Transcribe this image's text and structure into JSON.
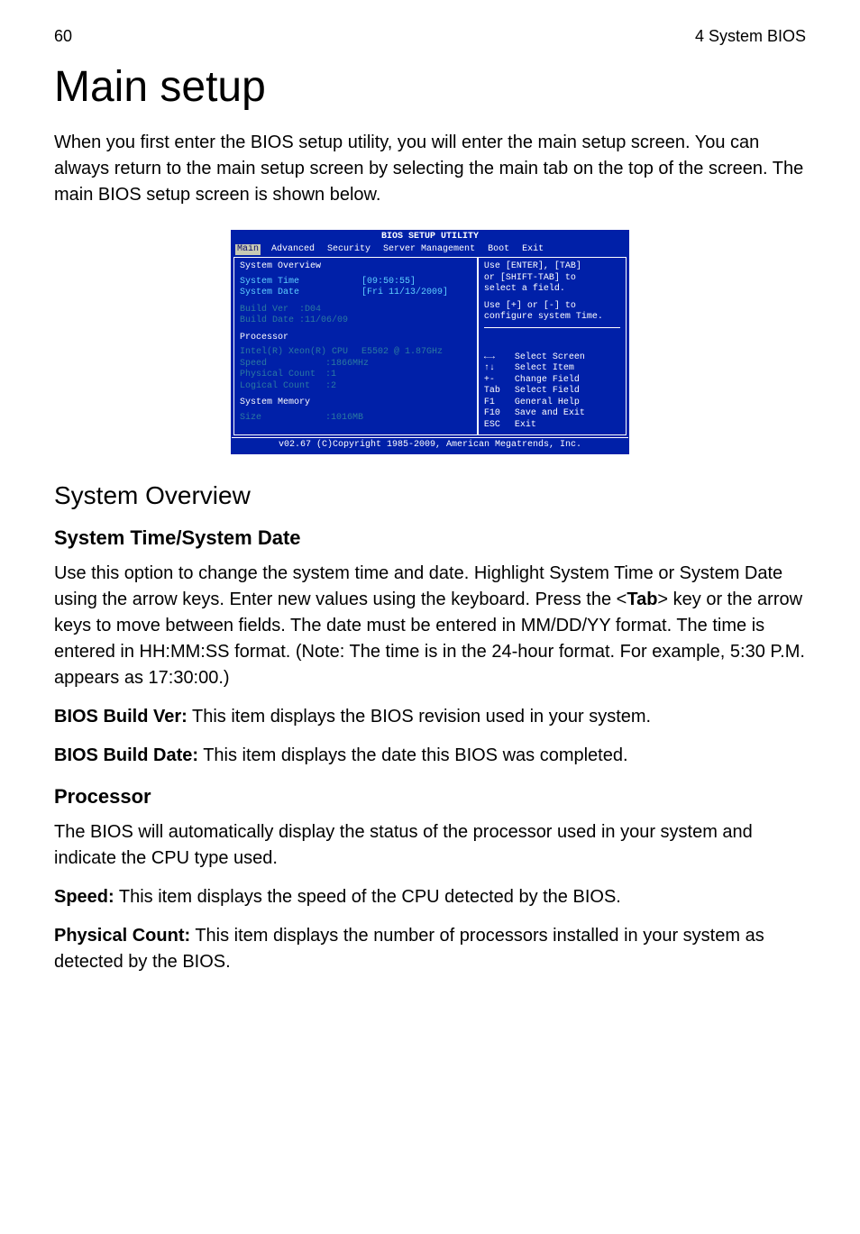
{
  "header": {
    "page_number": "60",
    "chapter": "4 System BIOS"
  },
  "title": "Main setup",
  "intro": "When you first enter the BIOS setup utility, you will enter the main setup screen. You can always return to the main setup screen by selecting the main tab on the top of the screen. The main BIOS setup screen is shown below.",
  "bios": {
    "title": "BIOS SETUP UTILITY",
    "tabs": [
      "Main",
      "Advanced",
      "Security",
      "Server Management",
      "Boot",
      "Exit"
    ],
    "active_tab": "Main",
    "left": {
      "overview_heading": "System Overview",
      "system_time_label": "System Time",
      "system_time_value": "[09:50:55]",
      "system_date_label": "System Date",
      "system_date_value": "[Fri 11/13/2009]",
      "build_ver_label": "Build Ver",
      "build_ver_value": ":D04",
      "build_date_label": "Build Date",
      "build_date_value": ":11/06/09",
      "processor_heading": "Processor",
      "cpu_name": "Intel(R) Xeon(R) CPU",
      "cpu_model": "E5502  @ 1.87GHz",
      "speed_label": "Speed",
      "speed_value": ":1866MHz",
      "phys_count_label": "Physical Count",
      "phys_count_value": ":1",
      "log_count_label": "Logical Count",
      "log_count_value": ":2",
      "memory_heading": "System Memory",
      "size_label": "Size",
      "size_value": ":1016MB"
    },
    "right": {
      "help1": "Use [ENTER], [TAB]",
      "help2": "or [SHIFT-TAB] to",
      "help3": "select a field.",
      "help4": "Use [+] or [-] to",
      "help5": "configure system Time.",
      "keys": [
        {
          "k": "←→",
          "d": "Select Screen"
        },
        {
          "k": "↑↓",
          "d": "Select Item"
        },
        {
          "k": "+-",
          "d": "Change Field"
        },
        {
          "k": "Tab",
          "d": "Select Field"
        },
        {
          "k": "F1",
          "d": "General Help"
        },
        {
          "k": "F10",
          "d": "Save and Exit"
        },
        {
          "k": "ESC",
          "d": "Exit"
        }
      ]
    },
    "footer": "v02.67 (C)Copyright 1985-2009, American Megatrends, Inc."
  },
  "sections": {
    "overview_heading": "System Overview",
    "time_date": {
      "heading": "System Time/System Date",
      "p1a": "Use this option to change the system time and date. Highlight System Time or System Date using the arrow keys. Enter new values using the keyboard. Press the <",
      "p1b": "Tab",
      "p1c": "> key or the arrow keys to move between fields. The date must be entered in MM/DD/YY format. The time is entered in HH:MM:SS format. (Note: The time is in the 24-hour format. For example, 5:30 P.M. appears as 17:30:00.)",
      "bios_ver_label": "BIOS Build Ver:",
      "bios_ver_text": " This item displays the BIOS revision used in your system.",
      "bios_date_label": "BIOS Build Date:",
      "bios_date_text": " This item displays the date this BIOS was completed."
    },
    "processor": {
      "heading": "Processor",
      "p1": "The BIOS will automatically display the status of the processor used in your system and indicate the CPU type used.",
      "speed_label": "Speed:",
      "speed_text": " This item displays the speed of the CPU detected by the BIOS.",
      "phys_label": "Physical Count:",
      "phys_text": " This item displays the number of processors installed in your system as detected by the BIOS."
    }
  }
}
